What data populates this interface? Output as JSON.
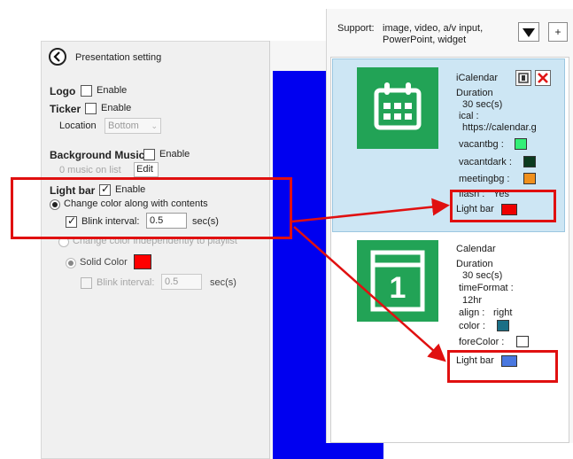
{
  "settings": {
    "title": "Presentation setting",
    "logo": {
      "label": "Logo",
      "enable_label": "Enable",
      "checked": false
    },
    "ticker": {
      "label": "Ticker",
      "enable_label": "Enable",
      "checked": false,
      "location_label": "Location",
      "location_value": "Bottom"
    },
    "background_music": {
      "label": "Background Music",
      "enable_label": "Enable",
      "checked": false,
      "music_count_text": "0 music on list",
      "edit_label": "Edit"
    },
    "light_bar": {
      "label": "Light bar",
      "enable_label": "Enable",
      "checked": true,
      "option_along": "Change color along with contents",
      "blink_label": "Blink interval:",
      "blink_value": "0.5",
      "unit": "sec(s)",
      "option_independent": "Change color independently to playlist",
      "solid_color_label": "Solid Color",
      "solid_color": "#ff0000",
      "blink_label_2": "Blink interval:",
      "blink_value_2": "0.5",
      "unit_2": "sec(s)"
    }
  },
  "panel": {
    "support_label": "Support:",
    "support_text_1": "image, video, a/v input,",
    "support_text_2": "PowerPoint, widget",
    "dropdown_icon": "triangle-down",
    "add_label": "+",
    "widgets": [
      {
        "name": "iCalendar",
        "duration_label": "Duration",
        "duration_value": "30  sec(s)",
        "ical_label": "ical :",
        "ical_value": "https://calendar.g",
        "vacantbg_label": "vacantbg :",
        "vacantbg_color": "#33ee77",
        "vacantdark_label": "vacantdark :",
        "vacantdark_color": "#0b3b1f",
        "meetingbg_label": "meetingbg :",
        "meetingbg_color": "#f0901c",
        "flash_label": "flash :",
        "flash_value": "Yes",
        "lightbar_label": "Light bar",
        "lightbar_color": "#ee0000"
      },
      {
        "name": "Calendar",
        "tile_number": "1",
        "duration_label": "Duration",
        "duration_value": "30  sec(s)",
        "timeformat_label": "timeFormat :",
        "timeformat_value": "12hr",
        "align_label": "align :",
        "align_value": "right",
        "color_label": "color :",
        "color_value": "#1b6f86",
        "forecolor_label": "foreColor :",
        "forecolor_value": "#ffffff",
        "lightbar_label": "Light bar",
        "lightbar_color": "#4a78e0"
      }
    ]
  },
  "colors": {
    "highlight": "#e01010",
    "preview_blue": "#0000f0",
    "tile_green": "#22a356"
  }
}
